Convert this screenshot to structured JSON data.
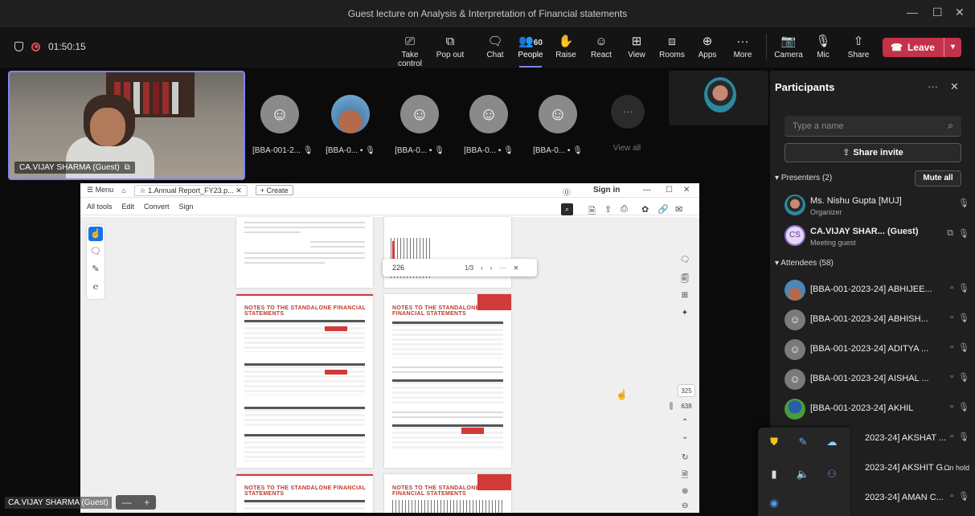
{
  "window": {
    "title": "Guest lecture on Analysis & Interpretation of Financial statements",
    "minimize": "—",
    "maximize": "☐",
    "close": "✕"
  },
  "toolbar": {
    "timer": "01:50:15",
    "buttons": [
      {
        "label": "Take control",
        "icon": "⎚"
      },
      {
        "label": "Pop out",
        "icon": "⧉"
      },
      {
        "label": "Chat",
        "icon": "🗨"
      },
      {
        "label": "People",
        "icon": "👥",
        "count": "60"
      },
      {
        "label": "Raise",
        "icon": "✋"
      },
      {
        "label": "React",
        "icon": "☺"
      },
      {
        "label": "View",
        "icon": "⊞"
      },
      {
        "label": "Rooms",
        "icon": "⧈"
      },
      {
        "label": "Apps",
        "icon": "⊕"
      },
      {
        "label": "More",
        "icon": "···"
      },
      {
        "label": "Camera",
        "icon": "📷"
      },
      {
        "label": "Mic",
        "icon": "🎙"
      },
      {
        "label": "Share",
        "icon": "⇧"
      }
    ],
    "leave_label": "Leave",
    "accent": "#7f85f5",
    "leave_color": "#c4314b"
  },
  "stage": {
    "speaker_name": "CA.VIJAY SHARMA (Guest)",
    "attendees": [
      {
        "name": "[BBA-001-2..."
      },
      {
        "name": "[BBA-0..."
      },
      {
        "name": "[BBA-0..."
      },
      {
        "name": "[BBA-0..."
      },
      {
        "name": "[BBA-0..."
      }
    ],
    "view_all": "View all",
    "view_all_icon": "···",
    "bottom_name": "CA.VIJAY SHARMA (Guest)",
    "zoom_minus": "—",
    "zoom_plus": "+"
  },
  "pdf": {
    "menu_label": "Menu",
    "tab_title": "1.Annual Report_FY23.p...",
    "create_label": "+ Create",
    "sign_in": "Sign in",
    "menus": [
      "All tools",
      "Edit",
      "Convert",
      "Sign"
    ],
    "find_value": "226",
    "find_count": "1/3",
    "page_current": "325",
    "page_total": "638",
    "notes_heading": "NOTES TO THE STANDALONE FINANCIAL STATEMENTS"
  },
  "participants": {
    "title": "Participants",
    "search_placeholder": "Type a name",
    "share_invite": "Share invite",
    "presenters_label": "Presenters (2)",
    "mute_all": "Mute all",
    "presenters": [
      {
        "name": "Ms. Nishu Gupta [MUJ]",
        "role": "Organizer"
      },
      {
        "name": "CA.VIJAY SHAR... (Guest)",
        "role": "Meeting guest",
        "initials": "CS"
      }
    ],
    "attendees_label": "Attendees (58)",
    "attendees": [
      {
        "name": "[BBA-001-2023-24] ABHIJEE..."
      },
      {
        "name": "[BBA-001-2023-24] ABHISH..."
      },
      {
        "name": "[BBA-001-2023-24] ADITYA ..."
      },
      {
        "name": "[BBA-001-2023-24] AISHAL ..."
      },
      {
        "name": "[BBA-001-2023-24] AKHIL"
      },
      {
        "name": "2023-24] AKSHAT ..."
      },
      {
        "name": "2023-24] AKSHIT G...",
        "status": "On hold"
      },
      {
        "name": "2023-24] AMAN C..."
      }
    ]
  }
}
